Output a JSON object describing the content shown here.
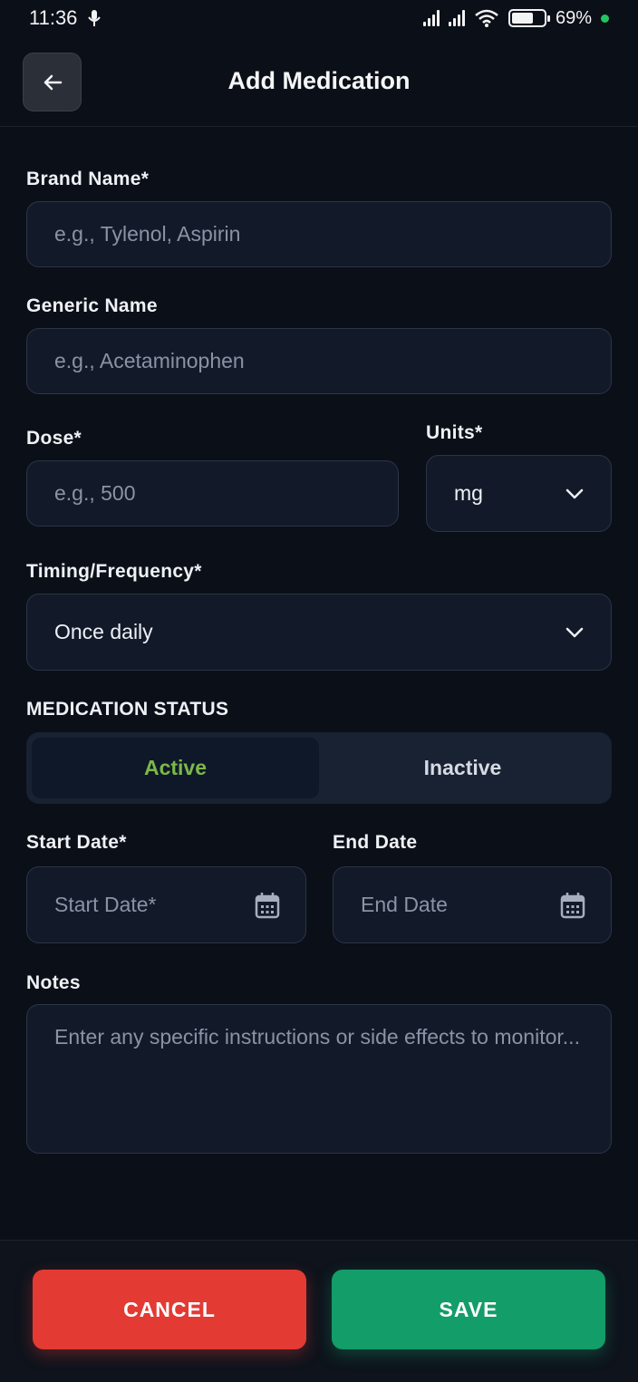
{
  "status_bar": {
    "time": "11:36",
    "battery": "69%",
    "battery_level": 0.69
  },
  "header": {
    "title": "Add Medication",
    "back_icon": "arrow-left-icon"
  },
  "form": {
    "brand_name": {
      "label": "Brand Name*",
      "placeholder": "e.g., Tylenol, Aspirin",
      "value": ""
    },
    "generic_name": {
      "label": "Generic Name",
      "placeholder": "e.g., Acetaminophen",
      "value": ""
    },
    "dose": {
      "label": "Dose*",
      "placeholder": "e.g., 500",
      "value": ""
    },
    "units": {
      "label": "Units*",
      "value": "mg"
    },
    "timing": {
      "label": "Timing/Frequency*",
      "value": "Once daily"
    },
    "status": {
      "label": "MEDICATION STATUS",
      "options": [
        "Active",
        "Inactive"
      ],
      "selected": "Active"
    },
    "start_date": {
      "label": "Start Date*",
      "placeholder": "Start Date*"
    },
    "end_date": {
      "label": "End Date",
      "placeholder": "End Date"
    },
    "notes": {
      "label": "Notes",
      "placeholder": "Enter any specific instructions or side effects to monitor..."
    }
  },
  "footer": {
    "cancel_label": "CANCEL",
    "save_label": "SAVE"
  },
  "colors": {
    "background": "#0b0f17",
    "field": "#121a2a",
    "active": "#7bb84a",
    "cancel": "#e33a34",
    "save": "#129d69"
  }
}
